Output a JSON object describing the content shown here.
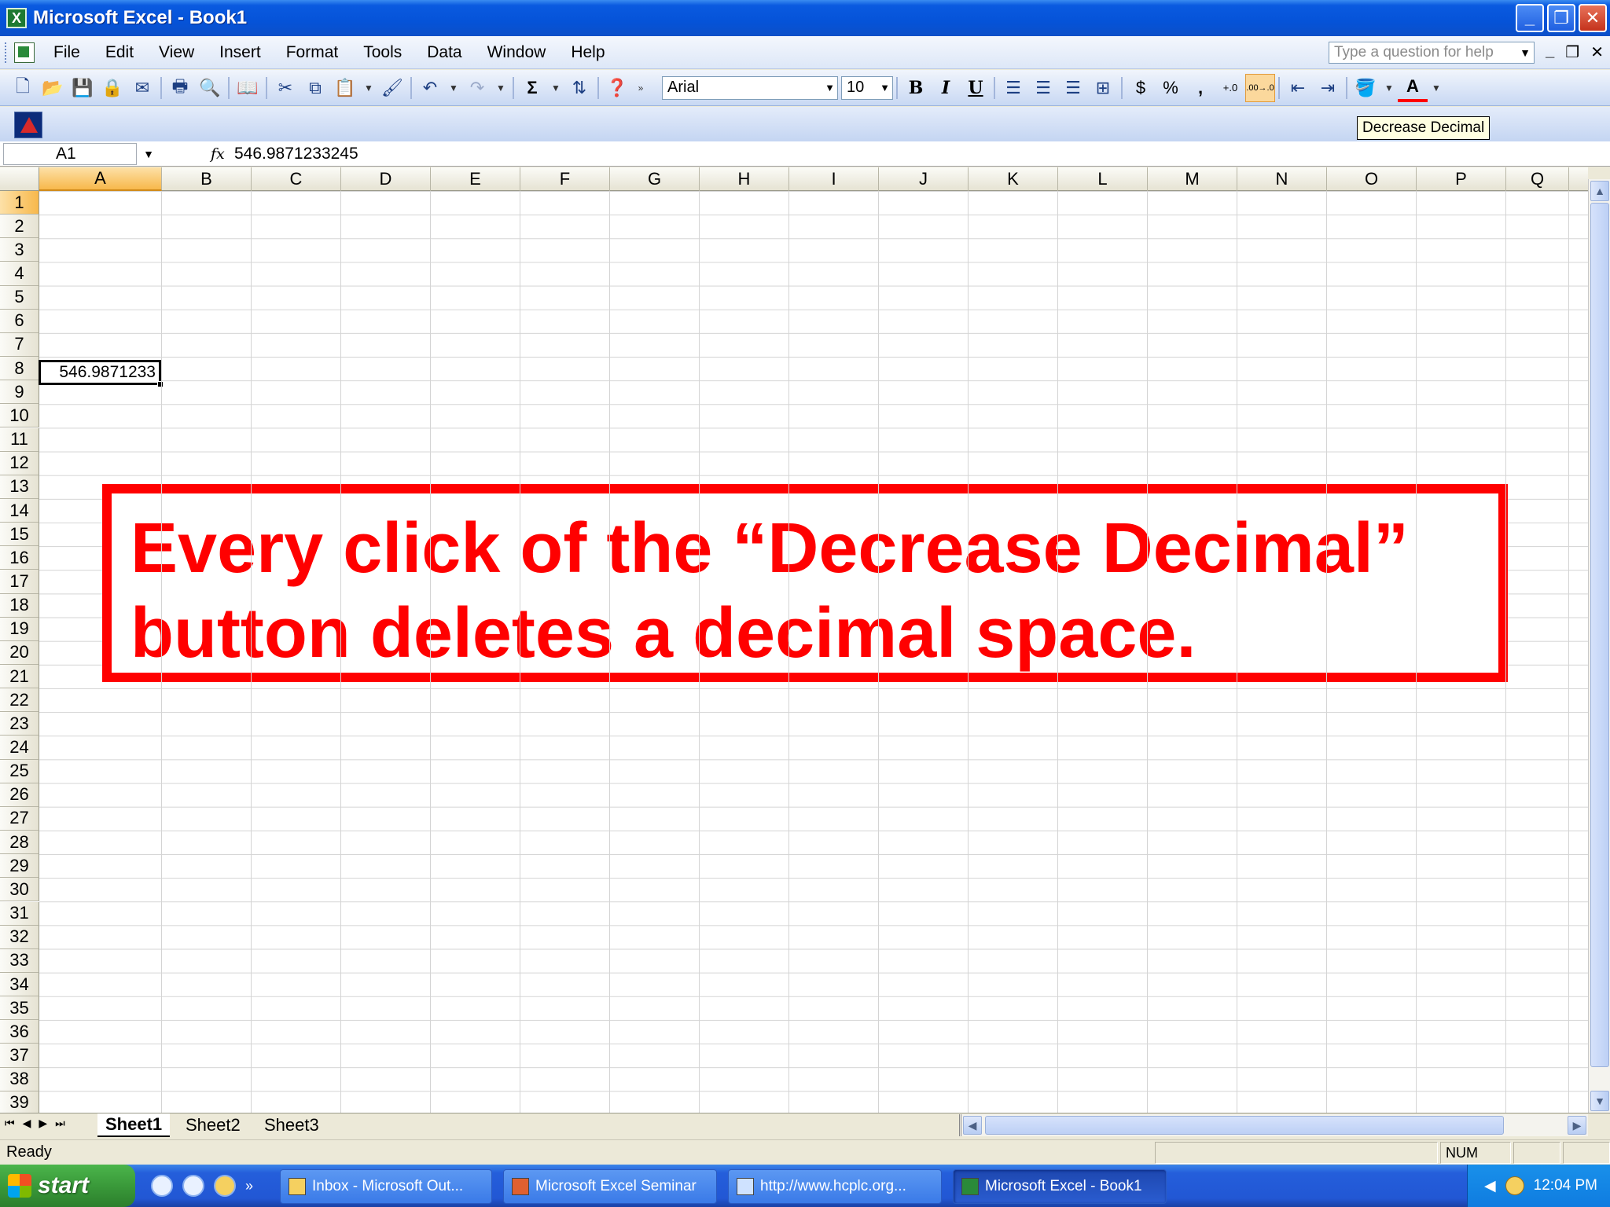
{
  "window": {
    "title": "Microsoft Excel - Book1",
    "app_icon": "X",
    "controls": [
      "_",
      "❐",
      "✕"
    ]
  },
  "menu": {
    "items": [
      "File",
      "Edit",
      "View",
      "Insert",
      "Format",
      "Tools",
      "Data",
      "Window",
      "Help"
    ],
    "help_placeholder": "Type a question for help",
    "doc_controls": [
      "_",
      "❐",
      "✕"
    ]
  },
  "toolbar": {
    "font_name": "Arial",
    "font_size": "10",
    "bold": "B",
    "italic": "I",
    "underline": "U",
    "sum": "Σ",
    "currency": "$",
    "percent": "%",
    "comma": ",",
    "increase_decimal": "+.0",
    "decrease_decimal": ".00→.0",
    "font_color": "A",
    "tooltip": "Decrease Decimal"
  },
  "formula_bar": {
    "name_box": "A1",
    "fx": "fx",
    "value": "546.9871233245"
  },
  "grid": {
    "columns": [
      "A",
      "B",
      "C",
      "D",
      "E",
      "F",
      "G",
      "H",
      "I",
      "J",
      "K",
      "L",
      "M",
      "N",
      "O",
      "P",
      "Q"
    ],
    "rows": [
      "1",
      "2",
      "3",
      "4",
      "5",
      "6",
      "7",
      "8",
      "9",
      "10",
      "11",
      "12",
      "13",
      "14",
      "15",
      "16",
      "17",
      "18",
      "19",
      "20",
      "21",
      "22",
      "23",
      "24",
      "25",
      "26",
      "27",
      "28",
      "29",
      "30",
      "31",
      "32",
      "33",
      "34",
      "35",
      "36",
      "37",
      "38",
      "39"
    ],
    "active_cell_value": "546.9871233"
  },
  "callout": {
    "line1": "Every click of the “Decrease Decimal”",
    "line2": "button deletes a decimal space."
  },
  "sheets": {
    "tabs": [
      "Sheet1",
      "Sheet2",
      "Sheet3"
    ],
    "active": "Sheet1"
  },
  "status": {
    "text": "Ready",
    "num": "NUM"
  },
  "taskbar": {
    "start": "start",
    "tasks": [
      "Inbox - Microsoft Out...",
      "Microsoft Excel Seminar",
      "http://www.hcplc.org...",
      "Microsoft Excel - Book1"
    ],
    "clock": "12:04 PM"
  },
  "colors": {
    "accent": "#ff0000",
    "title_blue": "#0553d8",
    "active_header": "#f7b84b"
  }
}
